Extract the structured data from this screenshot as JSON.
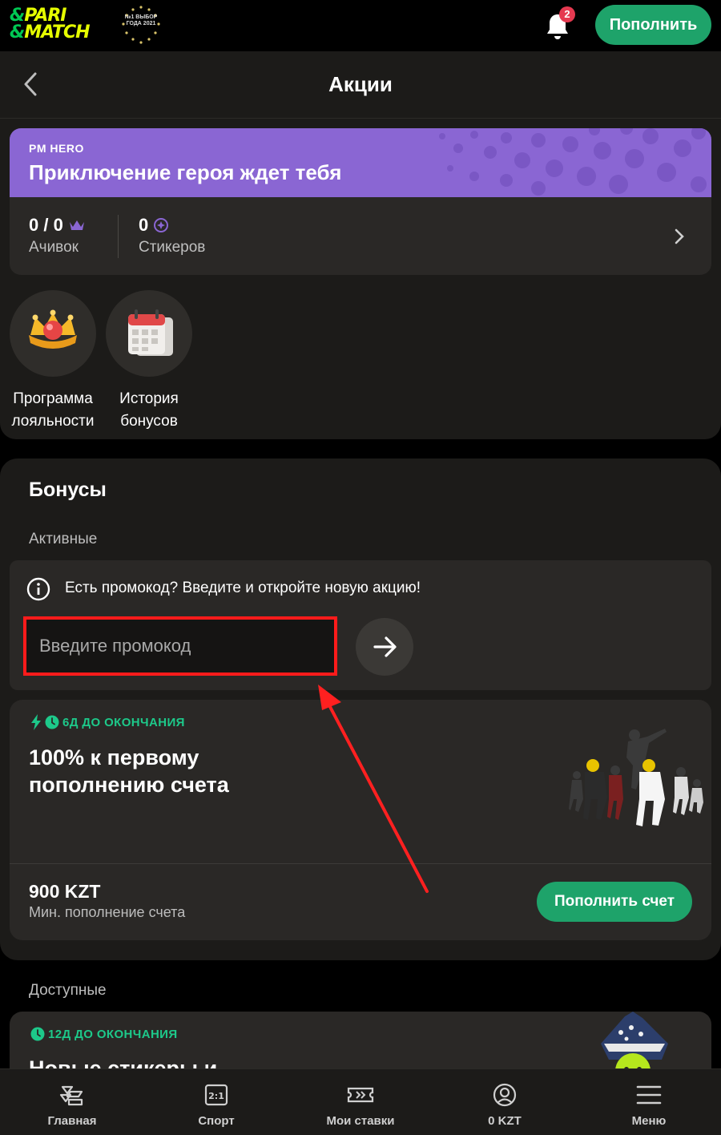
{
  "header": {
    "logo_top": "PARI",
    "logo_bottom": "MATCH",
    "award_text": "№1 ВЫБОР ГОДА 2021",
    "notification_count": "2",
    "deposit_label": "Пополнить"
  },
  "page": {
    "title": "Акции"
  },
  "hero": {
    "kicker": "PM HERO",
    "title": "Приключение героя ждет тебя",
    "achievements_value": "0 / 0",
    "achievements_label": "Ачивок",
    "stickers_value": "0",
    "stickers_label": "Стикеров",
    "accent_color": "#8a66d3"
  },
  "shortcuts": [
    {
      "label_line1": "Программа",
      "label_line2": "лояльности",
      "icon": "crown-icon"
    },
    {
      "label_line1": "История",
      "label_line2": "бонусов",
      "icon": "calendar-icon"
    }
  ],
  "bonuses": {
    "title": "Бонусы",
    "active_label": "Активные",
    "available_label": "Доступные",
    "promo_hint": "Есть промокод? Введите и откройте новую акцию!",
    "promo_placeholder": "Введите промокод",
    "active_offer": {
      "timer": "6Д ДО ОКОНЧАНИЯ",
      "title": "100% к первому пополнению счета",
      "amount": "900 KZT",
      "amount_caption": "Мин. пополнение счета",
      "button_label": "Пополнить счет"
    },
    "available_offer": {
      "timer": "12Д ДО ОКОНЧАНИЯ",
      "title": "Новые стикеры и"
    }
  },
  "bottom_nav": [
    {
      "label": "Главная",
      "icon": "home-icon"
    },
    {
      "label": "Спорт",
      "icon": "scoreboard-icon"
    },
    {
      "label": "Мои ставки",
      "icon": "ticket-icon"
    },
    {
      "label": "0 KZT",
      "icon": "account-icon"
    },
    {
      "label": "Меню",
      "icon": "menu-icon"
    }
  ],
  "colors": {
    "brand_green": "#1ea36a",
    "timer_green": "#1dc98a",
    "badge_red": "#e53950",
    "highlight_red": "#ff1b1b"
  }
}
